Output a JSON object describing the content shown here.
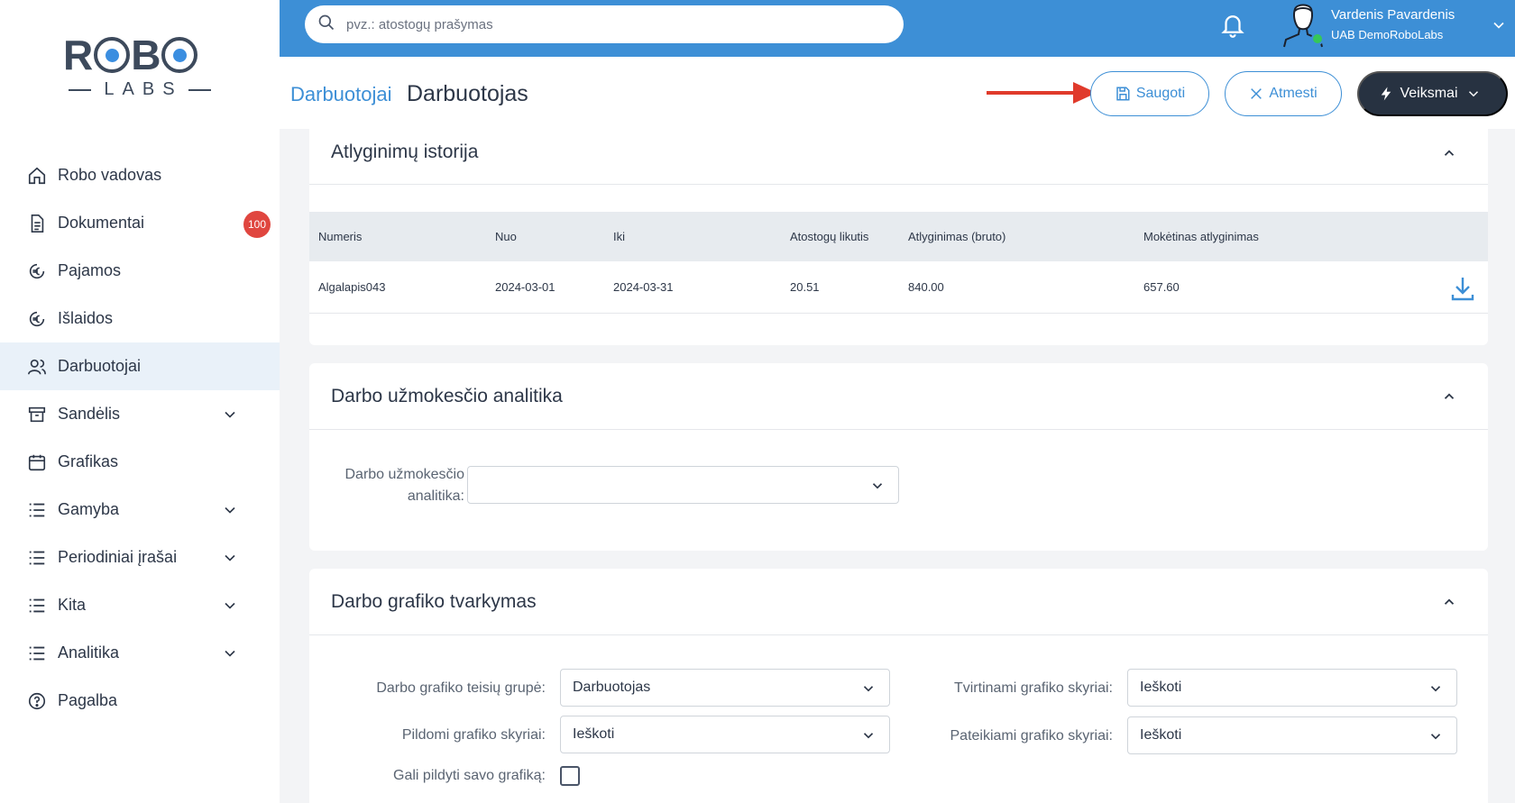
{
  "logo": {
    "top": "ROBO",
    "bottom": "LABS"
  },
  "sidebar": {
    "items": [
      {
        "label": "Robo vadovas",
        "icon": "home-icon"
      },
      {
        "label": "Dokumentai",
        "icon": "document-icon",
        "badge": "100"
      },
      {
        "label": "Pajamos",
        "icon": "euro-icon"
      },
      {
        "label": "Išlaidos",
        "icon": "euro-icon"
      },
      {
        "label": "Darbuotojai",
        "icon": "users-icon",
        "active": true
      },
      {
        "label": "Sandėlis",
        "icon": "archive-icon",
        "expandable": true
      },
      {
        "label": "Grafikas",
        "icon": "calendar-icon"
      },
      {
        "label": "Gamyba",
        "icon": "list-icon",
        "expandable": true
      },
      {
        "label": "Periodiniai įrašai",
        "icon": "list-icon",
        "expandable": true
      },
      {
        "label": "Kita",
        "icon": "list-icon",
        "expandable": true
      },
      {
        "label": "Analitika",
        "icon": "list-icon",
        "expandable": true
      },
      {
        "label": "Pagalba",
        "icon": "help-icon"
      }
    ]
  },
  "topbar": {
    "search_placeholder": "pvz.: atostogų prašymas",
    "user_name": "Vardenis Pavardenis",
    "user_company": "UAB DemoRoboLabs"
  },
  "header": {
    "breadcrumb": "Darbuotojai",
    "title": "Darbuotojas",
    "save_label": "Saugoti",
    "cancel_label": "Atmesti",
    "actions_label": "Veiksmai"
  },
  "salary_history": {
    "title": "Atlyginimų istorija",
    "columns": [
      "Numeris",
      "Nuo",
      "Iki",
      "Atostogų likutis",
      "Atlyginimas (bruto)",
      "Mokėtinas atlyginimas"
    ],
    "rows": [
      [
        "Algalapis043",
        "2024-03-01",
        "2024-03-31",
        "20.51",
        "840.00",
        "657.60"
      ]
    ]
  },
  "payroll_analytics": {
    "title": "Darbo užmokesčio analitika",
    "label_line1": "Darbo užmokesčio",
    "label_line2": "analitika:",
    "value": ""
  },
  "schedule": {
    "title": "Darbo grafiko tvarkymas",
    "rights_group_label": "Darbo grafiko teisių grupė:",
    "rights_group_value": "Darbuotojas",
    "filled_label": "Pildomi grafiko skyriai:",
    "filled_value": "Ieškoti",
    "can_fill_label": "Gali pildyti savo grafiką:",
    "approved_label": "Tvirtinami grafiko skyriai:",
    "approved_value": "Ieškoti",
    "submitted_label": "Pateikiami grafiko skyriai:",
    "submitted_value": "Ieškoti"
  },
  "colors": {
    "primary": "#3d8fd6",
    "dark_button": "#273241",
    "badge": "#e0463f",
    "arrow": "#e03a2b",
    "active_nav": "#e9f1f9"
  }
}
